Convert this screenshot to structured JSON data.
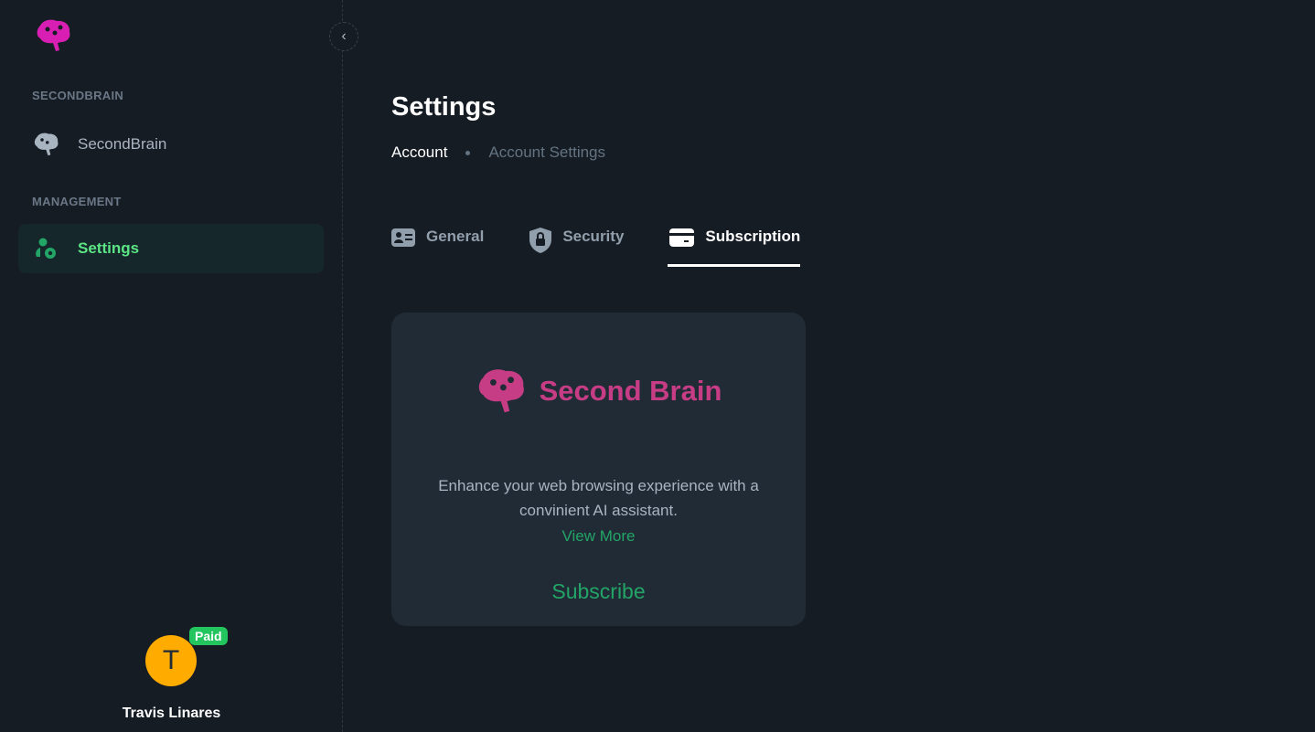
{
  "sidebar": {
    "sections": [
      {
        "title": "SECONDBRAIN",
        "items": [
          {
            "label": "SecondBrain"
          }
        ]
      },
      {
        "title": "MANAGEMENT",
        "items": [
          {
            "label": "Settings"
          }
        ]
      }
    ],
    "collapse_icon": "‹"
  },
  "user": {
    "initial": "T",
    "badge": "Paid",
    "name": "Travis Linares"
  },
  "page": {
    "title": "Settings",
    "breadcrumb": [
      "Account",
      "Account Settings"
    ]
  },
  "tabs": [
    {
      "label": "General"
    },
    {
      "label": "Security"
    },
    {
      "label": "Subscription"
    }
  ],
  "card": {
    "brand": "Second Brain",
    "description": "Enhance your web browsing experience with a convinient AI assistant.",
    "view_more": "View More",
    "subscribe": "Subscribe"
  },
  "colors": {
    "accent": "#5be584",
    "brand": "#c63d85",
    "badge": "#22c55e",
    "avatar": "#ffab00"
  }
}
